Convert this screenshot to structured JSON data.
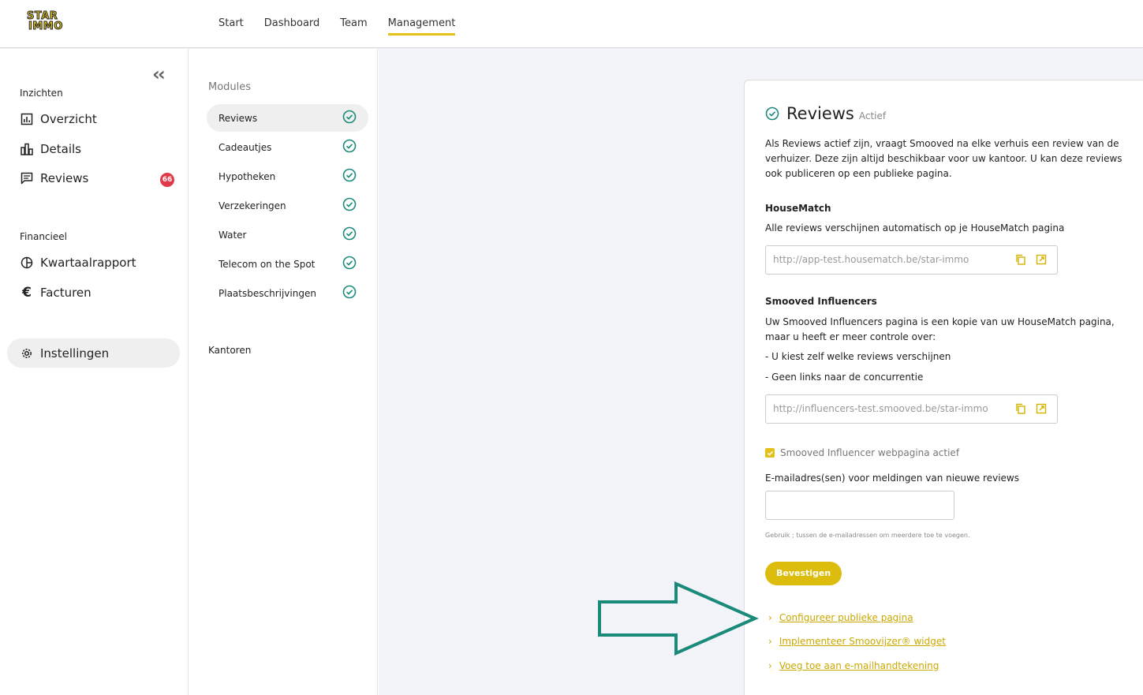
{
  "logo": {
    "line1": "STAR",
    "line2": "IMMO"
  },
  "topnav": [
    {
      "label": "Start",
      "active": false
    },
    {
      "label": "Dashboard",
      "active": false
    },
    {
      "label": "Team",
      "active": false
    },
    {
      "label": "Management",
      "active": true
    }
  ],
  "sidebar": {
    "sections": {
      "insights": "Inzichten",
      "financial": "Financieel"
    },
    "items": {
      "overzicht": "Overzicht",
      "details": "Details",
      "reviews": "Reviews",
      "reviews_badge": "66",
      "kwartaal": "Kwartaalrapport",
      "facturen": "Facturen",
      "instellingen": "Instellingen"
    }
  },
  "modules": {
    "title": "Modules",
    "items": [
      "Reviews",
      "Cadeautjes",
      "Hypotheken",
      "Verzekeringen",
      "Water",
      "Telecom on the Spot",
      "Plaatsbeschrijvingen"
    ],
    "kantoren": "Kantoren"
  },
  "card": {
    "title": "Reviews",
    "status": "Actief",
    "intro": "Als Reviews actief zijn, vraagt Smooved na elke verhuis een review van de verhuizer. Deze zijn altijd beschikbaar voor uw kantoor. U kan deze reviews ook publiceren op een publieke pagina.",
    "housematch_title": "HouseMatch",
    "housematch_desc": "Alle reviews verschijnen automatisch op je HouseMatch pagina",
    "housematch_url": "http://app-test.housematch.be/star-immo",
    "influencers_title": "Smooved Influencers",
    "influencers_desc": "Uw Smooved Influencers pagina is een kopie van uw HouseMatch pagina, maar u heeft er meer controle over:",
    "bullet1": "- U kiest zelf welke reviews verschijnen",
    "bullet2": "- Geen links naar de concurrentie",
    "influencers_url": "http://influencers-test.smooved.be/star-immo",
    "checkbox_label": "Smooved Influencer webpagina actief",
    "email_label": "E-mailadres(sen) voor meldingen van nieuwe reviews",
    "email_value": "",
    "hint": "Gebruik ; tussen de e-mailadressen om meerdere toe te voegen.",
    "confirm_button": "Bevestigen",
    "links": [
      "Configureer publieke pagina",
      "Implementeer Smoovijzer® widget",
      "Voeg toe aan e-mailhandtekening"
    ]
  },
  "colors": {
    "accent": "#e2c21a",
    "teal": "#1a8a7a",
    "badge": "#e03a4a"
  }
}
